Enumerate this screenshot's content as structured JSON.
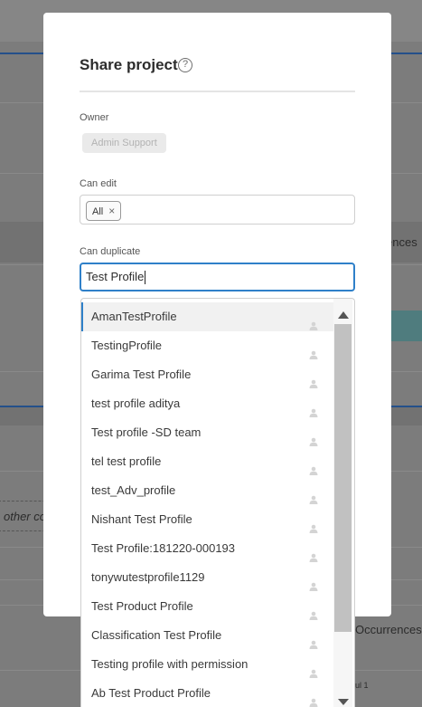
{
  "background": {
    "text_right_1": "ences",
    "text_left": "other co",
    "text_right_2": "Occurrences",
    "text_small": "ul 1"
  },
  "modal": {
    "title": "Share project",
    "help_glyph": "?",
    "owner": {
      "label": "Owner",
      "value": "Admin Support"
    },
    "can_edit": {
      "label": "Can edit",
      "chip": "All",
      "chip_remove": "×"
    },
    "can_duplicate": {
      "label": "Can duplicate",
      "value": "Test Profile"
    }
  },
  "dropdown": {
    "options": [
      "AmanTestProfile",
      "TestingProfile",
      "Garima Test Profile",
      "test profile aditya",
      "Test profile -SD team",
      "tel test profile",
      "test_Adv_profile",
      "Nishant Test Profile",
      "Test Profile:181220-000193",
      "tonywutestprofile1129",
      "Test Product Profile",
      "Classification Test Profile",
      "Testing profile with permission",
      "Ab Test Product Profile"
    ],
    "option_icon": "user-icon"
  },
  "colors": {
    "accent": "#2f80c9",
    "overlay": "#7c7c7c",
    "teal_row": "#4f7c7e"
  }
}
